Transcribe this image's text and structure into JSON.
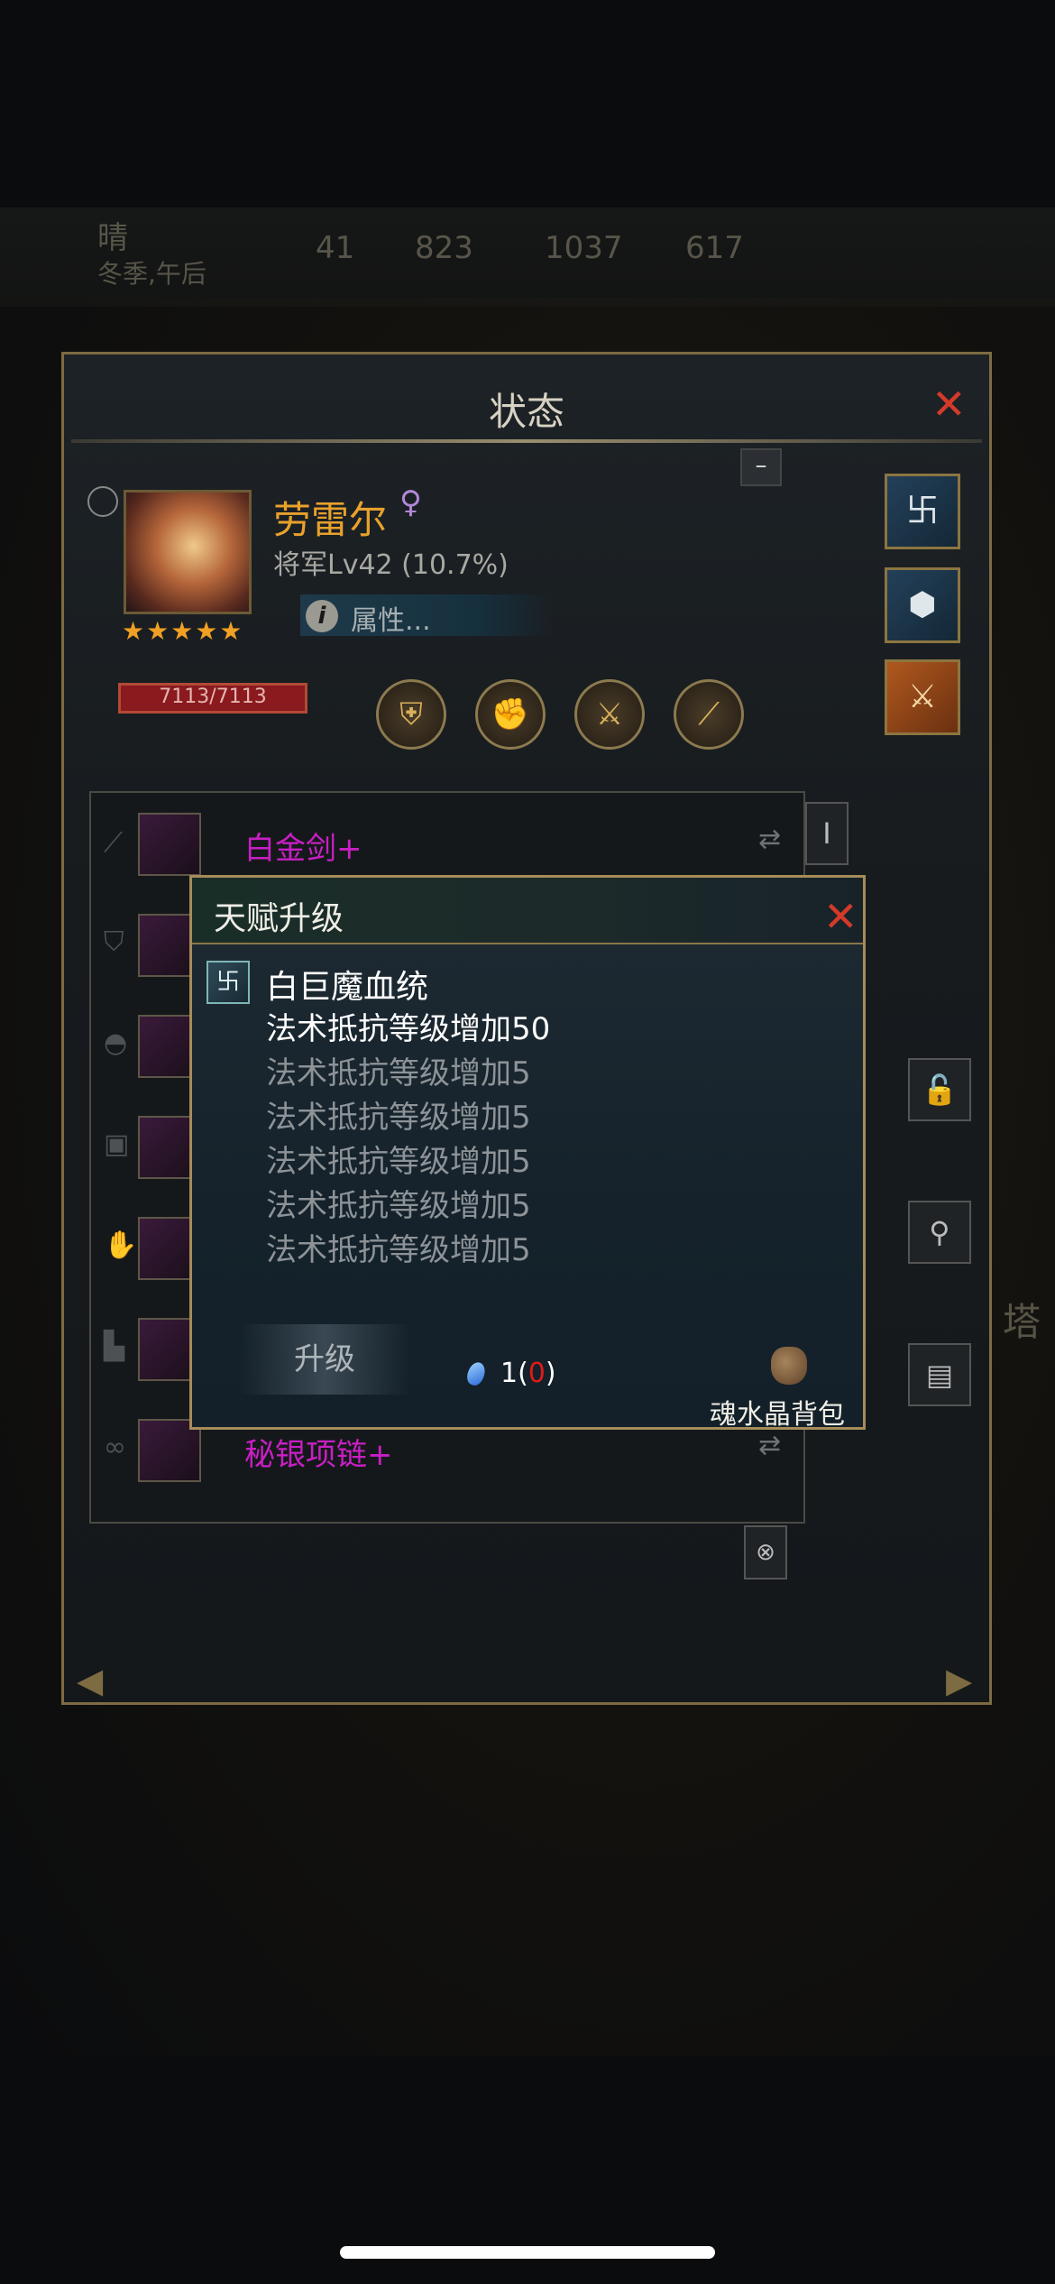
{
  "hud": {
    "weather": "晴",
    "season_time": "冬季,午后",
    "res_gold": "41",
    "res_food": "823",
    "res_energy": "1037",
    "res_coin": "617",
    "right_text": "塔"
  },
  "panel": {
    "title": "状态",
    "close": "✕",
    "minus": "–",
    "hero": {
      "name": "劳雷尔",
      "gender": "♀",
      "level": "将军Lv42 (10.7%)",
      "stars": "★★★★★",
      "attributes_label": "属性...",
      "hp": "7113/7113"
    },
    "equipment": [
      {
        "name": "白金剑+",
        "icon": "sword-icon"
      },
      {
        "name": "",
        "icon": "shield-icon"
      },
      {
        "name": "",
        "icon": "helmet-icon"
      },
      {
        "name": "",
        "icon": "armor-icon"
      },
      {
        "name": "",
        "icon": "gauntlet-icon"
      },
      {
        "name": "",
        "icon": "boots-icon"
      },
      {
        "name": "秘银项链+",
        "icon": "necklace-icon"
      }
    ],
    "swap_symbol": "⇄"
  },
  "popup": {
    "title": "天赋升级",
    "close": "✕",
    "talent_name": "白巨魔血统",
    "lines": [
      "法术抵抗等级增加50",
      "法术抵抗等级增加5",
      "法术抵抗等级增加5",
      "法术抵抗等级增加5",
      "法术抵抗等级增加5",
      "法术抵抗等级增加5"
    ],
    "upgrade_label": "升级",
    "cost_prefix": "1(",
    "cost_have": "0",
    "cost_suffix": ")",
    "bag_label": "魂水晶背包"
  },
  "colors": {
    "accent_gold": "#e8a12c",
    "close_red": "#d43a2a",
    "item_purple": "#c81fc4"
  }
}
